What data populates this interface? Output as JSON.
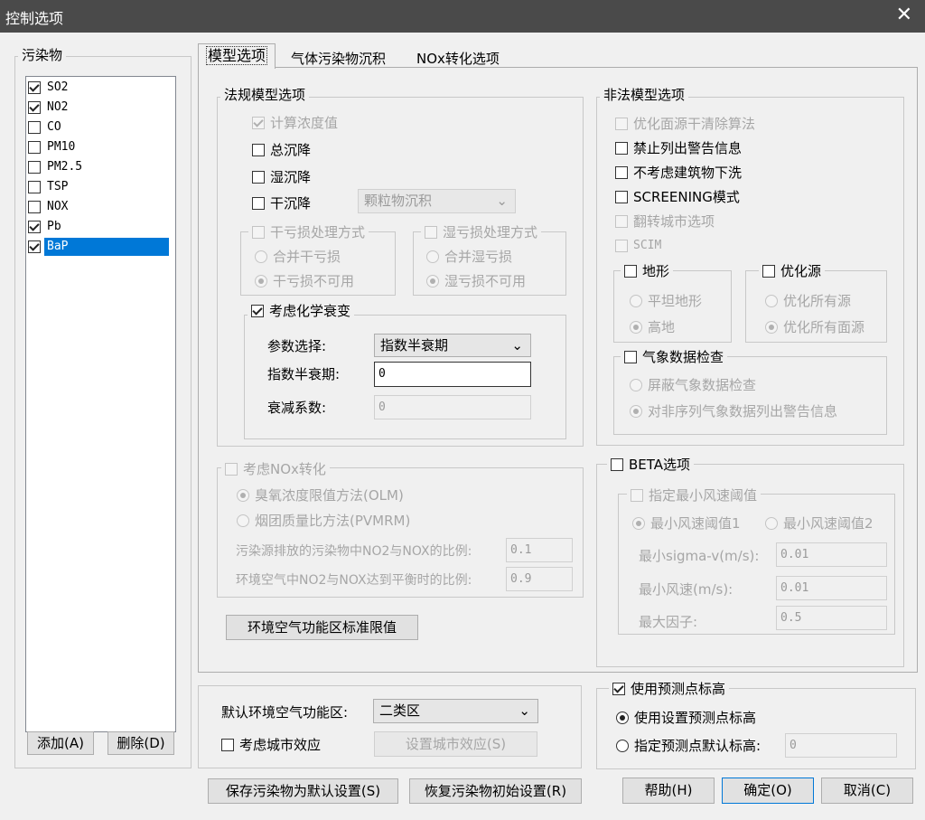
{
  "window": {
    "title": "控制选项",
    "close_glyph": "✕"
  },
  "pollutants": {
    "legend": "污染物",
    "items": [
      {
        "label": "SO2",
        "checked": true
      },
      {
        "label": "NO2",
        "checked": true
      },
      {
        "label": "CO",
        "checked": false
      },
      {
        "label": "PM10",
        "checked": false
      },
      {
        "label": "PM2.5",
        "checked": false
      },
      {
        "label": "TSP",
        "checked": false
      },
      {
        "label": "NOX",
        "checked": false
      },
      {
        "label": "Pb",
        "checked": true
      },
      {
        "label": "BaP",
        "checked": true,
        "selected": true
      }
    ],
    "add_label": "添加(A)",
    "delete_label": "删除(D)"
  },
  "tabs": [
    "模型选项",
    "气体污染物沉积",
    "NOx转化选项"
  ],
  "regulatory": {
    "legend": "法规模型选项",
    "calc_conc": "计算浓度值",
    "total_dep": "总沉降",
    "wet_dep": "湿沉降",
    "dry_dep": "干沉降",
    "dry_dep_select": "颗粒物沉积",
    "dry_loss": {
      "legend": "干亏损处理方式",
      "opt1": "合并干亏损",
      "opt2": "干亏损不可用"
    },
    "wet_loss": {
      "legend": "湿亏损处理方式",
      "opt1": "合并湿亏损",
      "opt2": "湿亏损不可用"
    },
    "decay": {
      "legend": "考虑化学衰变",
      "param_label": "参数选择:",
      "param_value": "指数半衰期",
      "halflife_label": "指数半衰期:",
      "halflife_value": "0",
      "coef_label": "衰减系数:",
      "coef_value": "0"
    }
  },
  "nonregulatory": {
    "legend": "非法模型选项",
    "opt_area": "优化面源干清除算法",
    "no_warn": "禁止列出警告信息",
    "no_building": "不考虑建筑物下洗",
    "screening": "SCREENING模式",
    "flip_urban": "翻转城市选项",
    "scim": "SCIM",
    "terrain": {
      "legend": "地形",
      "opt1": "平坦地形",
      "opt2": "高地"
    },
    "optsrc": {
      "legend": "优化源",
      "opt1": "优化所有源",
      "opt2": "优化所有面源"
    },
    "met": {
      "legend": "气象数据检查",
      "opt1": "屏蔽气象数据检查",
      "opt2": "对非序列气象数据列出警告信息"
    }
  },
  "nox": {
    "legend": "考虑NOx转化",
    "olm": "臭氧浓度限值方法(OLM)",
    "pvmrm": "烟团质量比方法(PVMRM)",
    "ratio1_label": "污染源排放的污染物中NO2与NOX的比例:",
    "ratio1_value": "0.1",
    "ratio2_label": "环境空气中NO2与NOX达到平衡时的比例:",
    "ratio2_value": "0.9"
  },
  "aq_std_button": "环境空气功能区标准限值",
  "beta": {
    "legend": "BETA选项",
    "wind": {
      "legend": "指定最小风速阈值",
      "opt1": "最小风速阈值1",
      "opt2": "最小风速阈值2",
      "sigma_label": "最小sigma-v(m/s):",
      "sigma_value": "0.01",
      "minwind_label": "最小风速(m/s):",
      "minwind_value": "0.01",
      "maxfactor_label": "最大因子:",
      "maxfactor_value": "0.5"
    }
  },
  "bottom": {
    "default_zone_label": "默认环境空气功能区:",
    "default_zone_value": "二类区",
    "urban_effect": "考虑城市效应",
    "set_urban_button": "设置城市效应(S)"
  },
  "receptor": {
    "legend": "使用预测点标高",
    "opt1": "使用设置预测点标高",
    "opt2": "指定预测点默认标高:",
    "value": "0"
  },
  "footer": {
    "save_default": "保存污染物为默认设置(S)",
    "restore_default": "恢复污染物初始设置(R)",
    "help": "帮助(H)",
    "ok": "确定(O)",
    "cancel": "取消(C)"
  }
}
